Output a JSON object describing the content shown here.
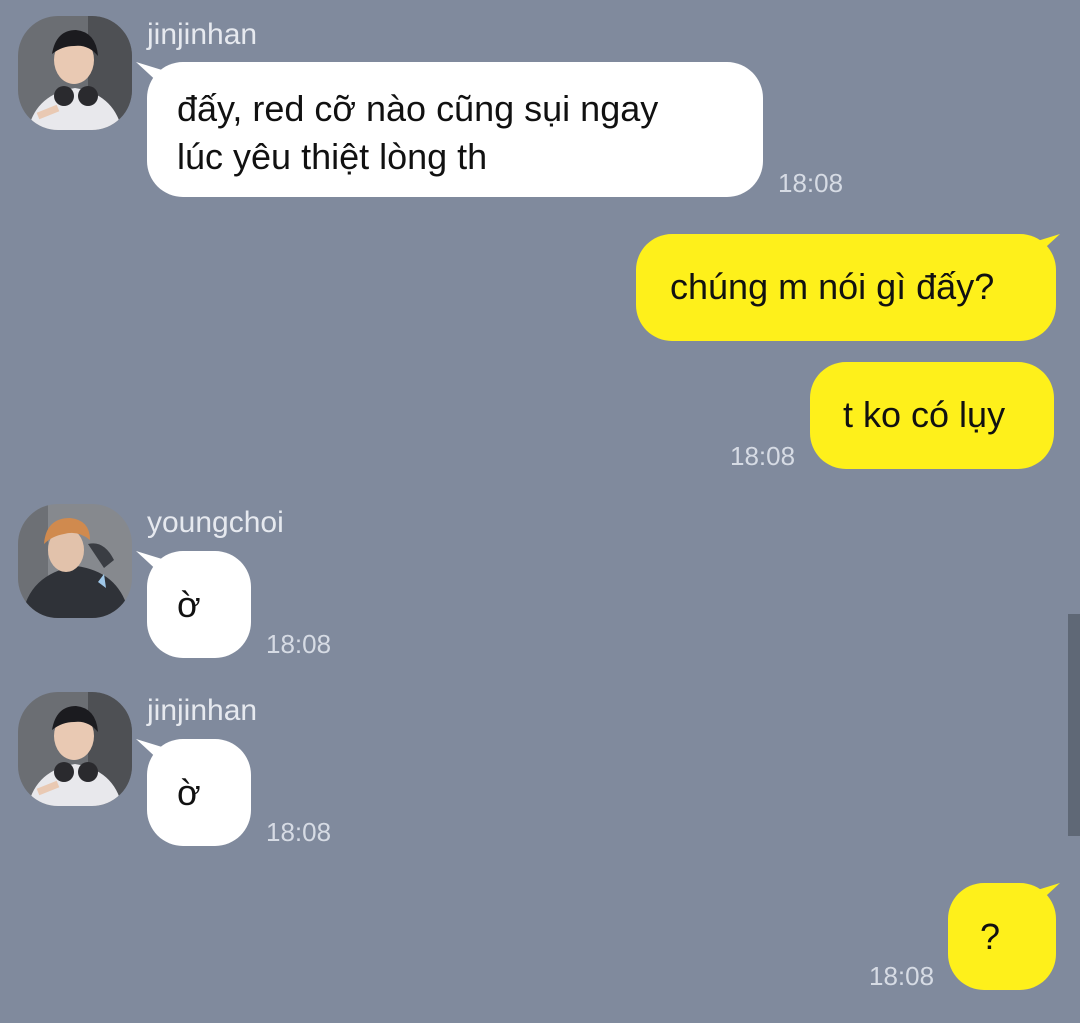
{
  "messages": [
    {
      "direction": "incoming",
      "sender": "jinjinhan",
      "avatar": "jinjinhan-avatar",
      "text": "đấy, red cỡ nào cũng sụi ngay\nlúc yêu thiệt lòng th",
      "time": "18:08"
    },
    {
      "direction": "outgoing",
      "text": "chúng m nói gì đấy?",
      "time": ""
    },
    {
      "direction": "outgoing",
      "text": "t ko có lụy",
      "time": "18:08"
    },
    {
      "direction": "incoming",
      "sender": "youngchoi",
      "avatar": "youngchoi-avatar",
      "text": "ờ",
      "time": "18:08"
    },
    {
      "direction": "incoming",
      "sender": "jinjinhan",
      "avatar": "jinjinhan-avatar",
      "text": "ờ",
      "time": "18:08"
    },
    {
      "direction": "outgoing",
      "text": "?",
      "time": "18:08"
    }
  ],
  "colors": {
    "background": "#808a9d",
    "incoming_bubble": "#ffffff",
    "outgoing_bubble": "#fef01b",
    "meta_text": "#d6dbe4"
  }
}
